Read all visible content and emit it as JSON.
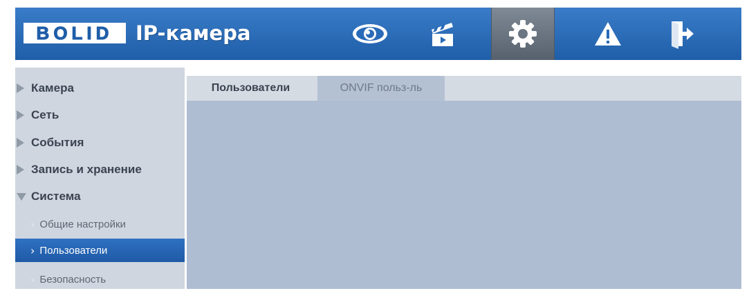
{
  "header": {
    "logo_text": "BOLID",
    "product_title": "IP-камера",
    "nav": [
      {
        "icon": "eye-icon",
        "name": "live-view"
      },
      {
        "icon": "clapperboard-icon",
        "name": "playback"
      },
      {
        "icon": "gear-icon",
        "name": "settings",
        "active": true
      },
      {
        "icon": "warning-icon",
        "name": "alarm"
      },
      {
        "icon": "logout-icon",
        "name": "logout"
      }
    ]
  },
  "sidebar": {
    "items": [
      {
        "label": "Камера",
        "expanded": false
      },
      {
        "label": "Сеть",
        "expanded": false
      },
      {
        "label": "События",
        "expanded": false
      },
      {
        "label": "Запись и хранение",
        "expanded": false
      },
      {
        "label": "Система",
        "expanded": true
      }
    ],
    "subitems": [
      {
        "label": "Общие настройки"
      },
      {
        "label": "Пользователи",
        "selected": true
      },
      {
        "label": "Безопасность"
      }
    ]
  },
  "main": {
    "tabs": [
      {
        "label": "Пользователи",
        "active": true
      },
      {
        "label": "ONVIF польз-ль",
        "active": false
      }
    ]
  },
  "colors": {
    "header_blue": "#2a6bb8",
    "selected_blue": "#2a67b5",
    "content_bg": "#afbdd3",
    "sidebar_bg": "#cfd6e0"
  }
}
